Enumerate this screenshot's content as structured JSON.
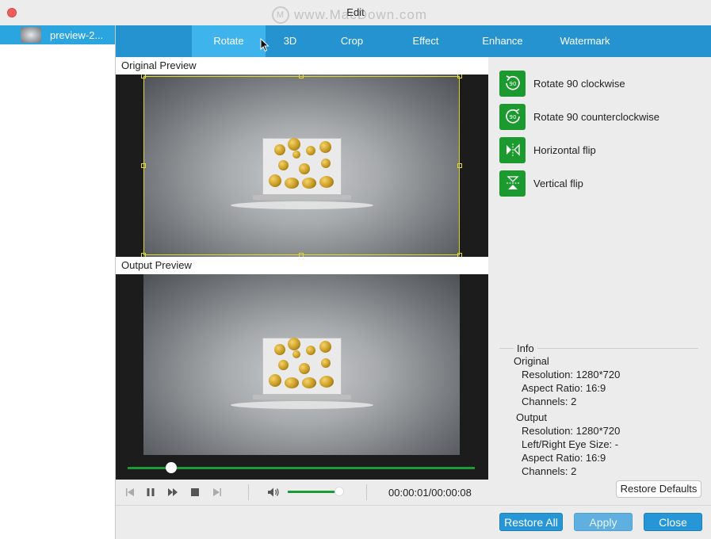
{
  "window": {
    "title": "Edit",
    "watermark_text": "www.MacDown.com",
    "watermark_logo": "M"
  },
  "sidebar": {
    "items": [
      {
        "label": "preview-2..."
      }
    ]
  },
  "tabs": [
    {
      "label": "Rotate",
      "active": true
    },
    {
      "label": "3D",
      "active": false
    },
    {
      "label": "Crop",
      "active": false
    },
    {
      "label": "Effect",
      "active": false
    },
    {
      "label": "Enhance",
      "active": false
    },
    {
      "label": "Watermark",
      "active": false
    }
  ],
  "preview": {
    "original_label": "Original Preview",
    "output_label": "Output Preview"
  },
  "player": {
    "timecode": "00:00:01/00:00:08",
    "progress": 0.125,
    "volume": 0.95,
    "icons": [
      "skip-back-icon",
      "pause-icon",
      "fast-forward-icon",
      "stop-icon",
      "skip-forward-icon",
      "volume-icon"
    ]
  },
  "rotate_actions": [
    {
      "label": "Rotate 90 clockwise",
      "icon": "rotate-clockwise-icon",
      "icon_text": "90"
    },
    {
      "label": "Rotate 90 counterclockwise",
      "icon": "rotate-counterclockwise-icon",
      "icon_text": "90"
    },
    {
      "label": "Horizontal flip",
      "icon": "horizontal-flip-icon"
    },
    {
      "label": "Vertical flip",
      "icon": "vertical-flip-icon"
    }
  ],
  "info": {
    "title": "Info",
    "original": {
      "heading": "Original",
      "resolution": "Resolution: 1280*720",
      "aspect_ratio": "Aspect Ratio: 16:9",
      "channels": "Channels: 2"
    },
    "output": {
      "heading": "Output",
      "resolution": "Resolution: 1280*720",
      "eye_size": "Left/Right Eye Size: -",
      "aspect_ratio": "Aspect Ratio: 16:9",
      "channels": "Channels: 2"
    },
    "restore_defaults_label": "Restore Defaults"
  },
  "footer": {
    "restore_all_label": "Restore All",
    "apply_label": "Apply",
    "close_label": "Close"
  },
  "colors": {
    "tab_bar": "#2493d0",
    "tab_active": "#3fb3ec",
    "accent_green": "#1d9a2f",
    "crop_box": "#e1db2e",
    "button_blue": "#2796d6"
  }
}
